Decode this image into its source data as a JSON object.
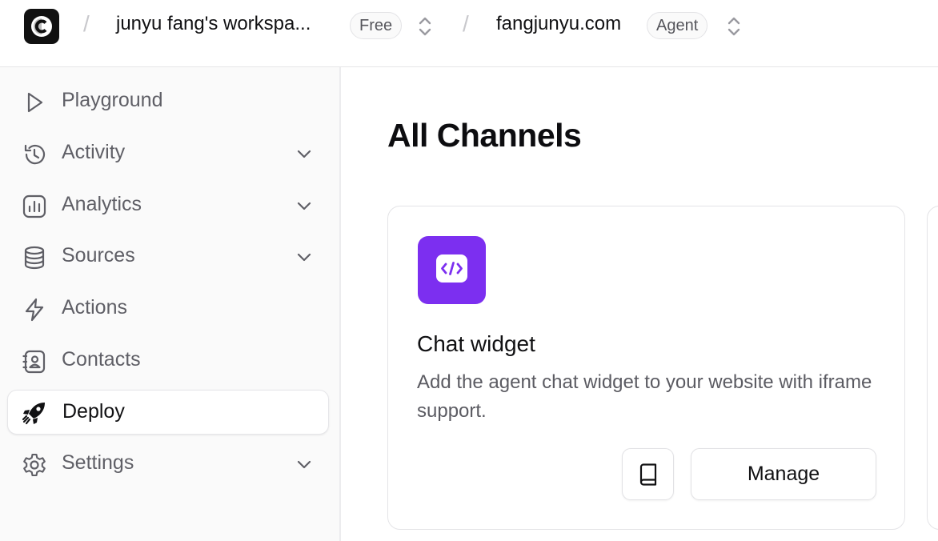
{
  "header": {
    "logo_letter": "C",
    "workspace_name": "junyu fang's workspa...",
    "workspace_plan": "Free",
    "agent_name": "fangjunyu.com",
    "agent_badge": "Agent",
    "separator": "/"
  },
  "sidebar": {
    "items": [
      {
        "label": "Playground",
        "icon": "play-icon",
        "has_chevron": false,
        "active": false
      },
      {
        "label": "Activity",
        "icon": "history-icon",
        "has_chevron": true,
        "active": false
      },
      {
        "label": "Analytics",
        "icon": "bar-chart-icon",
        "has_chevron": true,
        "active": false
      },
      {
        "label": "Sources",
        "icon": "database-icon",
        "has_chevron": true,
        "active": false
      },
      {
        "label": "Actions",
        "icon": "lightning-icon",
        "has_chevron": false,
        "active": false
      },
      {
        "label": "Contacts",
        "icon": "contact-book-icon",
        "has_chevron": false,
        "active": false
      },
      {
        "label": "Deploy",
        "icon": "rocket-icon",
        "has_chevron": false,
        "active": true
      },
      {
        "label": "Settings",
        "icon": "gear-icon",
        "has_chevron": true,
        "active": false
      }
    ]
  },
  "main": {
    "title": "All Channels",
    "channels": [
      {
        "name": "Chat widget",
        "description": "Add the agent chat widget to your website with iframe support.",
        "icon": "code-icon",
        "icon_color": "#7c2ff0",
        "manage_label": "Manage",
        "docs_icon": "book-icon"
      }
    ]
  }
}
